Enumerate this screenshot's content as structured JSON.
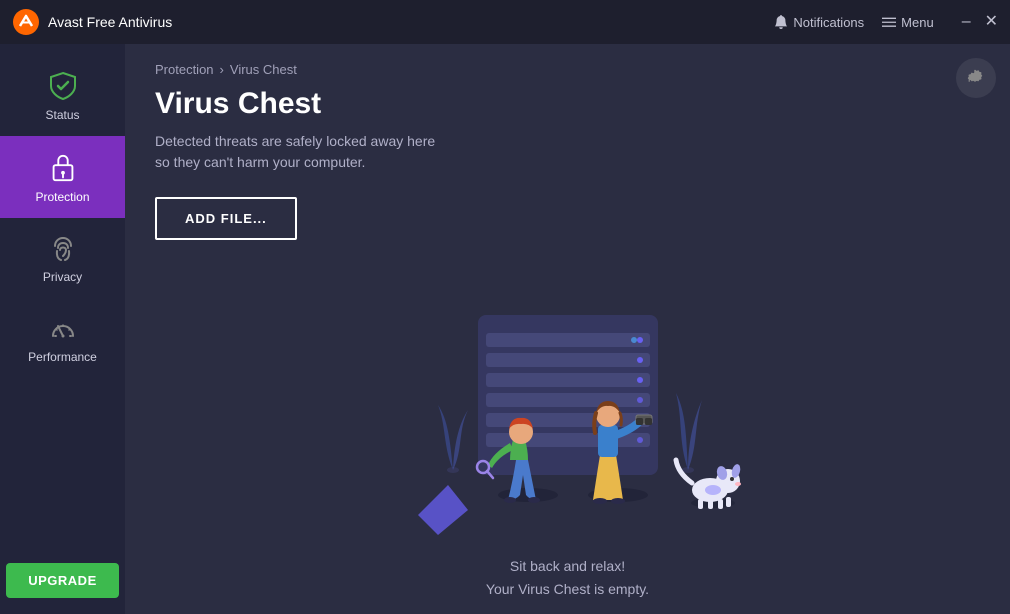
{
  "app": {
    "title": "Avast Free Antivirus"
  },
  "titlebar": {
    "notifications_label": "Notifications",
    "menu_label": "Menu"
  },
  "sidebar": {
    "items": [
      {
        "id": "status",
        "label": "Status",
        "active": false
      },
      {
        "id": "protection",
        "label": "Protection",
        "active": true
      },
      {
        "id": "privacy",
        "label": "Privacy",
        "active": false
      },
      {
        "id": "performance",
        "label": "Performance",
        "active": false
      }
    ],
    "upgrade_label": "UPGRADE"
  },
  "breadcrumb": {
    "parent": "Protection",
    "separator": "›",
    "current": "Virus Chest"
  },
  "page": {
    "title": "Virus Chest",
    "description_line1": "Detected threats are safely locked away here",
    "description_line2": "so they can't harm your computer.",
    "add_file_button": "ADD FILE...",
    "caption_line1": "Sit back and relax!",
    "caption_line2": "Your Virus Chest is empty."
  },
  "colors": {
    "accent_purple": "#7b2fbe",
    "accent_green": "#3dba4e",
    "bg_dark": "#22243a",
    "bg_content": "#2b2d42",
    "titlebar": "#1e1f2e"
  }
}
